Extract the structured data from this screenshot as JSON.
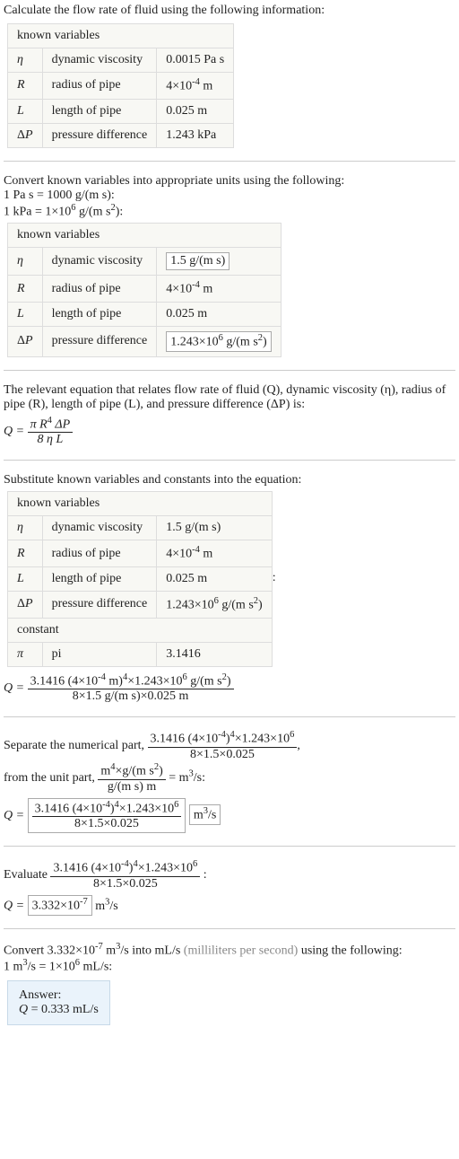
{
  "intro1": "Calculate the flow rate of fluid using the following information:",
  "table1": {
    "caption": "known variables",
    "rows": [
      {
        "sym": "η",
        "name": "dynamic viscosity",
        "val": "0.0015 Pa s"
      },
      {
        "sym": "R",
        "name": "radius of pipe",
        "val": "4×10",
        "exp": "-4",
        "suffix": " m"
      },
      {
        "sym": "L",
        "name": "length of pipe",
        "val": "0.025 m"
      },
      {
        "sym": "ΔP",
        "name": "pressure difference",
        "val": "1.243 kPa"
      }
    ]
  },
  "convert_title": "Convert known variables into appropriate units using the following:",
  "conv1_a": "1 Pa s = 1000 g/(m s):",
  "conv1_b_pre": "1 kPa = 1×10",
  "conv1_b_exp": "6",
  "conv1_b_post": " g/(m s",
  "conv1_b_post2": "):",
  "table2": {
    "caption": "known variables",
    "rows": [
      {
        "sym": "η",
        "name": "dynamic viscosity",
        "val": "1.5 g/(m s)",
        "boxed": true
      },
      {
        "sym": "R",
        "name": "radius of pipe",
        "val": "4×10",
        "exp": "-4",
        "suffix": " m"
      },
      {
        "sym": "L",
        "name": "length of pipe",
        "val": "0.025 m"
      },
      {
        "sym": "ΔP",
        "name": "pressure difference",
        "pre": "1.243×10",
        "exp": "6",
        "post": " g/(m s",
        "post2": ")",
        "boxed": true
      }
    ]
  },
  "eq_expl": "The relevant equation that relates flow rate of fluid (Q), dynamic viscosity (η), radius of pipe (R), length of pipe (L), and pressure difference (ΔP) is:",
  "eq1_lhs": "Q = ",
  "eq1_num_pre": "π R",
  "eq1_num_exp": "4",
  "eq1_num_post": " ΔP",
  "eq1_den": "8 η L",
  "sub_title": "Substitute known variables and constants into the equation:",
  "table3": {
    "caption": "known variables",
    "rows": [
      {
        "sym": "η",
        "name": "dynamic viscosity",
        "val": "1.5 g/(m s)"
      },
      {
        "sym": "R",
        "name": "radius of pipe",
        "val": "4×10",
        "exp": "-4",
        "suffix": " m"
      },
      {
        "sym": "L",
        "name": "length of pipe",
        "val": "0.025 m"
      },
      {
        "sym": "ΔP",
        "name": "pressure difference",
        "pre": "1.243×10",
        "exp": "6",
        "post": " g/(m s",
        "post2": ")"
      }
    ],
    "constant_caption": "constant",
    "pi_sym": "π",
    "pi_name": "pi",
    "pi_val": "3.1416"
  },
  "eq2_lhs": "Q = ",
  "eq2_num_a": "3.1416 (4×10",
  "eq2_num_a_exp": "-4",
  "eq2_num_a_post": " m)",
  "eq2_num_a_exp2": "4",
  "eq2_num_b_pre": "×1.243×10",
  "eq2_num_b_exp": "6",
  "eq2_num_b_post": " g/(m s",
  "eq2_num_b_post2": ")",
  "eq2_den": "8×1.5 g/(m s)×0.025 m",
  "sep_text_a": "Separate the numerical part, ",
  "sep_text_b": ",",
  "sep_text_c": "from the unit part, ",
  "sep_text_d_pre": " = m",
  "sep_text_d_exp": "3",
  "sep_text_d_post": "/s:",
  "unit_num_a": "m",
  "unit_num_a_exp": "4",
  "unit_num_b": "×g/(m s",
  "unit_num_b_exp": "2",
  "unit_num_b_post": ")",
  "unit_den": "g/(m s) m",
  "sep_num_a": "3.1416 (4×10",
  "sep_num_a_exp": "-4",
  "sep_num_a_post": ")",
  "sep_num_a_exp2": "4",
  "sep_num_b_pre": "×1.243×10",
  "sep_num_b_exp": "6",
  "sep_den": "8×1.5×0.025",
  "eq3_lhs": "Q = ",
  "m3s": "m",
  "m3s_exp": "3",
  "m3s_post": "/s",
  "eval_a": "Evaluate ",
  "eval_b": ":",
  "eq4_lhs": "Q = ",
  "eq4_box_pre": "3.332×10",
  "eq4_box_exp": "-7",
  "conv2_a_pre": "Convert 3.332×10",
  "conv2_a_exp": "-7",
  "conv2_a_mid": " m",
  "conv2_a_exp2": "3",
  "conv2_a_post": "/s into mL/s ",
  "conv2_gray": "(milliliters per second)",
  "conv2_tail": " using the following:",
  "conv2_line2_pre": "1 m",
  "conv2_line2_exp": "3",
  "conv2_line2_mid": "/s = 1×10",
  "conv2_line2_exp2": "6",
  "conv2_line2_post": " mL/s:",
  "answer_label": "Answer:",
  "answer_eq": "Q = 0.333 mL/s"
}
